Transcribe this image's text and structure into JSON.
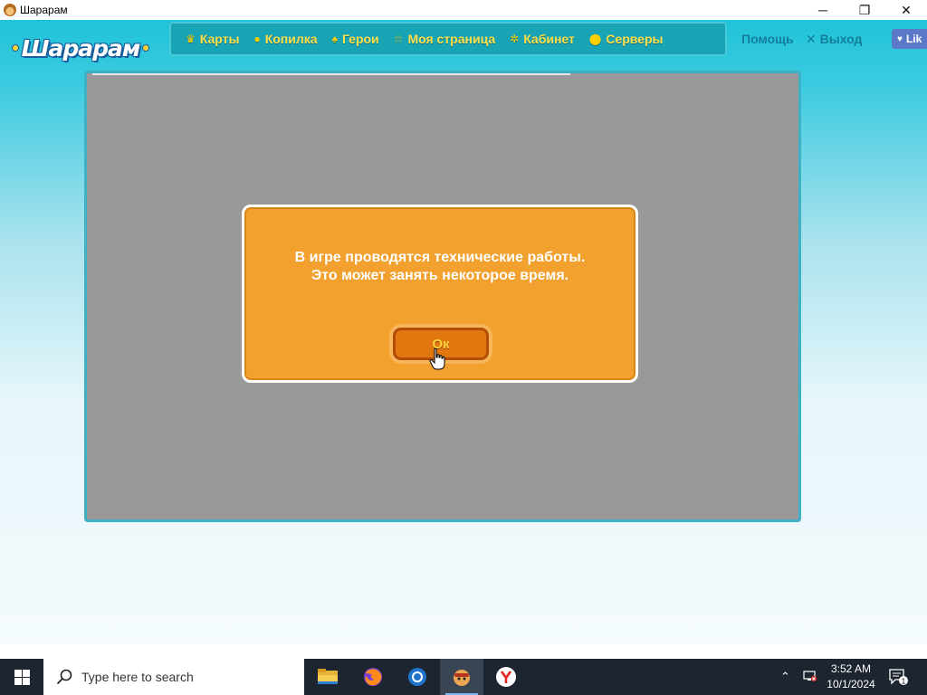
{
  "window": {
    "title": "Шарарам",
    "controls": {
      "minimize": "─",
      "maximize": "❐",
      "close": "✕"
    }
  },
  "logo_text": "Шарарам",
  "nav": [
    {
      "label": "Карты",
      "icon": "crown-icon",
      "glyph": "♛"
    },
    {
      "label": "Копилка",
      "icon": "piggy-bank-icon",
      "glyph": "●"
    },
    {
      "label": "Герои",
      "icon": "hero-icon",
      "glyph": "♠"
    },
    {
      "label": "Моя страница",
      "icon": "star-icon",
      "glyph": "☆"
    },
    {
      "label": "Кабинет",
      "icon": "gear-icon",
      "glyph": "✲"
    },
    {
      "label": "Серверы",
      "icon": "location-pin-icon",
      "glyph": "⬤"
    }
  ],
  "help_label": "Помощь",
  "logout_label": "Выход",
  "like_label": "Lik",
  "modal": {
    "line1": "В игре проводятся технические работы.",
    "line2": "Это может занять некоторое время.",
    "ok_label": "Ок"
  },
  "taskbar": {
    "search_placeholder": "Type here to search",
    "time": "3:52 AM",
    "date": "10/1/2024",
    "notification_count": "1"
  },
  "colors": {
    "navbar_bg": "#19a4b6",
    "nav_text": "#ffe04a",
    "modal_bg": "#f2a02e",
    "game_area": "#999999",
    "taskbar_bg": "#1c2530"
  }
}
